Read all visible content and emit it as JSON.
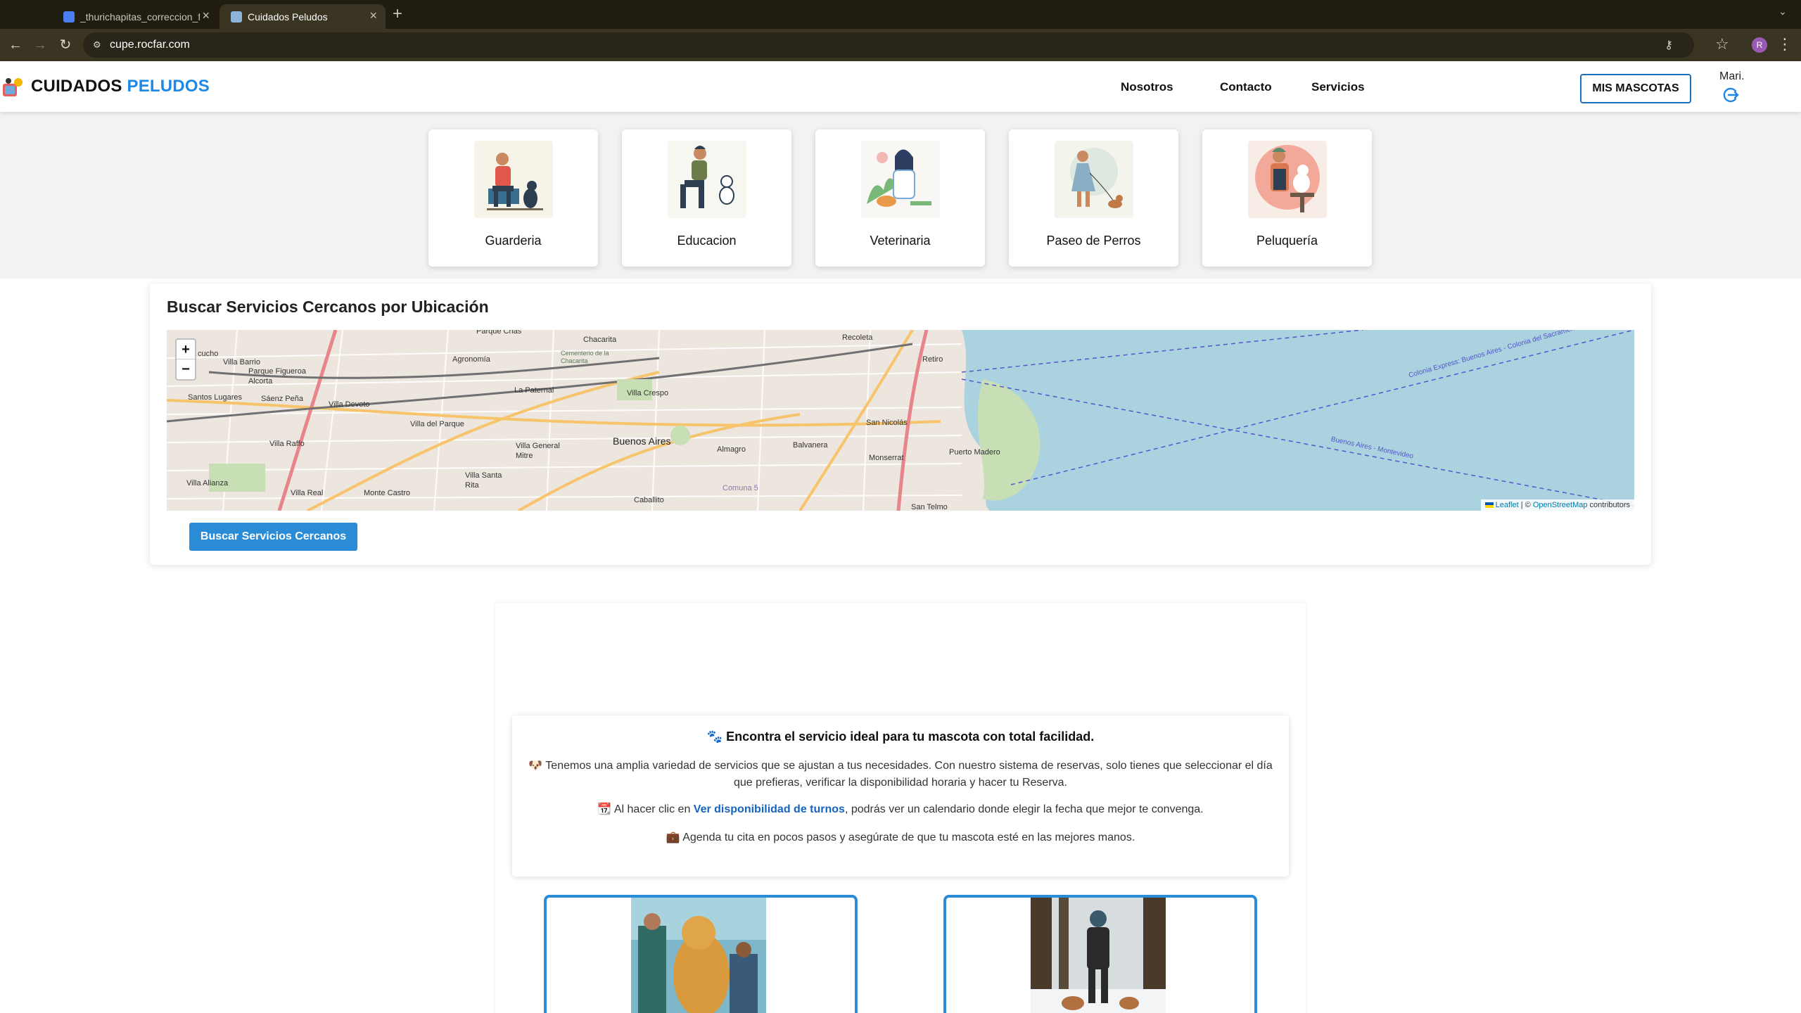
{
  "browser": {
    "tabs": [
      {
        "title": "_thurichapitas_correccion_fi",
        "active": false
      },
      {
        "title": "Cuidados Peludos",
        "active": true
      }
    ],
    "url": "cupe.rocfar.com",
    "profile_initial": "R"
  },
  "header": {
    "brand_part1": "CUIDADOS",
    "brand_part2": "PELUDOS",
    "nav": [
      "Nosotros",
      "Contacto",
      "Servicios"
    ],
    "mis_mascotas": "MIS MASCOTAS",
    "user": "Mari."
  },
  "services": [
    {
      "label": "Guarderia",
      "icon": "person-with-dog-illustration"
    },
    {
      "label": "Educacion",
      "icon": "dog-training-illustration"
    },
    {
      "label": "Veterinaria",
      "icon": "veterinarian-illustration"
    },
    {
      "label": "Paseo de Perros",
      "icon": "dog-walking-illustration"
    },
    {
      "label": "Peluquería",
      "icon": "dog-grooming-illustration"
    }
  ],
  "map_section": {
    "title": "Buscar Servicios Cercanos por Ubicación",
    "zoom_in": "+",
    "zoom_out": "−",
    "attribution_leaflet": "Leaflet",
    "attribution_sep": " | © ",
    "attribution_osm": "OpenStreetMap",
    "attribution_suffix": " contributors",
    "labels": [
      "Parque Chas",
      "Chacarita",
      "Recoleta",
      "Retiro",
      "Villa Barrio",
      "Parque Figueroa Alcorta",
      "Agronomía",
      "Cementerio de la Chacarita",
      "La Paternal",
      "Villa Crespo",
      "Santos Lugares",
      "Sáenz Peña",
      "Villa Devoto",
      "Villa del Parque",
      "Buenos Aires",
      "San Nicolás",
      "Villa Raffo",
      "Villa General Mitre",
      "Almagro",
      "Balvanera",
      "Monserrat",
      "Puerto Madero",
      "Villa Santa Rita",
      "Villa Alianza",
      "Villa Real",
      "Monte Castro",
      "Caballito",
      "Comuna 5",
      "San Telmo",
      "Colonia Express: Buenos Aires - Colonia del Sacramento",
      "Buenos Aires - Montevideo",
      "cucho"
    ],
    "button": "Buscar Servicios Cercanos"
  },
  "info": {
    "title": "🐾 Encontra el servicio ideal para tu mascota con total facilidad.",
    "p1": "🐶 Tenemos una amplia variedad de servicios que se ajustan a tus necesidades. Con nuestro sistema de reservas, solo tienes que seleccionar el día que prefieras, verificar la disponibilidad horaria y hacer tu Reserva.",
    "p2_prefix": "📆 Al hacer clic en ",
    "p2_link": "Ver disponibilidad de turnos",
    "p2_suffix": ", podrás ver un calendario donde elegir la fecha que mejor te convenga.",
    "p3": "💼 Agenda tu cita en pocos pasos y asegúrate de que tu mascota esté en las mejores manos."
  },
  "colors": {
    "brand_blue": "#1e88e5",
    "button_blue": "#2a8bd6"
  }
}
